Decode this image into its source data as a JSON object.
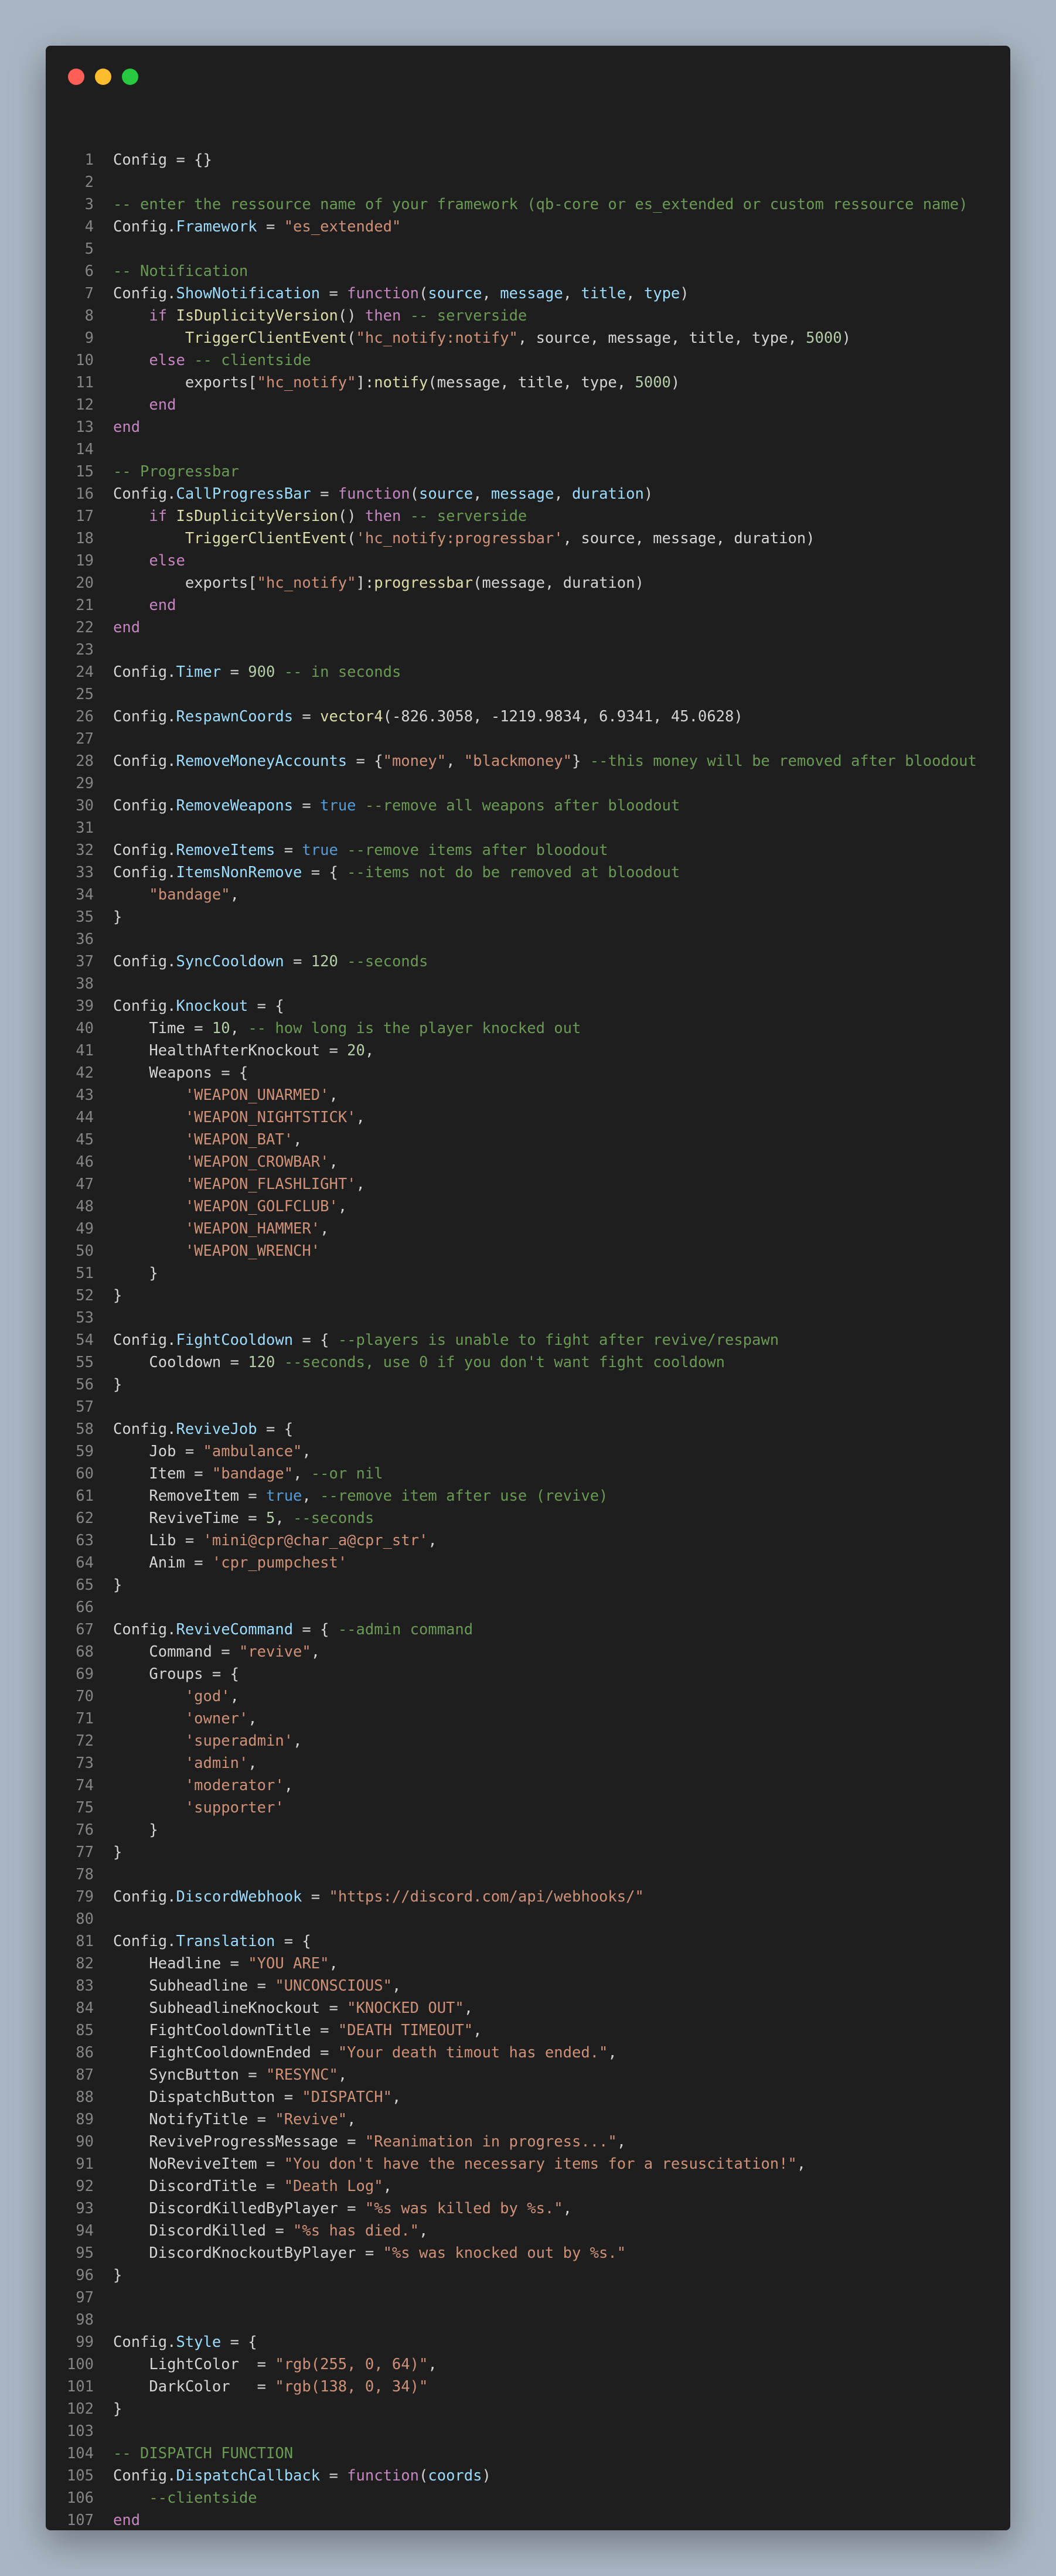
{
  "window": {
    "traffic_lights": [
      "close",
      "minimize",
      "maximize"
    ],
    "colors": {
      "background": "#1e1e1e",
      "close": "#ff5f57",
      "minimize": "#febc2e",
      "maximize": "#28c840"
    }
  },
  "syntax_colors": {
    "plain": "#d4d4d4",
    "keyword": "#c586c0",
    "function": "#dcdcaa",
    "property": "#9cdcfe",
    "string": "#ce9178",
    "number": "#b5cea8",
    "comment": "#6a9955",
    "boolean": "#569cd6",
    "line_number": "#858585"
  },
  "code_lines": [
    [
      [
        "p",
        "Config = {}"
      ]
    ],
    [],
    [
      [
        "cm",
        "-- enter the ressource name of your framework (qb-core or es_extended or custom ressource name)"
      ]
    ],
    [
      [
        "p",
        "Config."
      ],
      [
        "pr",
        "Framework"
      ],
      [
        "p",
        " = "
      ],
      [
        "s",
        "\"es_extended\""
      ]
    ],
    [],
    [
      [
        "cm",
        "-- Notification"
      ]
    ],
    [
      [
        "p",
        "Config."
      ],
      [
        "pr",
        "ShowNotification"
      ],
      [
        "p",
        " = "
      ],
      [
        "k",
        "function"
      ],
      [
        "p",
        "("
      ],
      [
        "pr",
        "source"
      ],
      [
        "p",
        ", "
      ],
      [
        "pr",
        "message"
      ],
      [
        "p",
        ", "
      ],
      [
        "pr",
        "title"
      ],
      [
        "p",
        ", "
      ],
      [
        "pr",
        "type"
      ],
      [
        "p",
        ")"
      ]
    ],
    [
      [
        "p",
        "    "
      ],
      [
        "k",
        "if"
      ],
      [
        "p",
        " "
      ],
      [
        "f",
        "IsDuplicityVersion"
      ],
      [
        "p",
        "() "
      ],
      [
        "k",
        "then"
      ],
      [
        "p",
        " "
      ],
      [
        "cm",
        "-- serverside"
      ]
    ],
    [
      [
        "p",
        "        "
      ],
      [
        "f",
        "TriggerClientEvent"
      ],
      [
        "p",
        "("
      ],
      [
        "s",
        "\"hc_notify:notify\""
      ],
      [
        "p",
        ", source, message, title, type, "
      ],
      [
        "n",
        "5000"
      ],
      [
        "p",
        ")"
      ]
    ],
    [
      [
        "p",
        "    "
      ],
      [
        "k",
        "else"
      ],
      [
        "p",
        " "
      ],
      [
        "cm",
        "-- clientside"
      ]
    ],
    [
      [
        "p",
        "        exports["
      ],
      [
        "s",
        "\"hc_notify\""
      ],
      [
        "p",
        "]:"
      ],
      [
        "f",
        "notify"
      ],
      [
        "p",
        "(message, title, type, "
      ],
      [
        "n",
        "5000"
      ],
      [
        "p",
        ")"
      ]
    ],
    [
      [
        "p",
        "    "
      ],
      [
        "k",
        "end"
      ]
    ],
    [
      [
        "k",
        "end"
      ]
    ],
    [],
    [
      [
        "cm",
        "-- Progressbar"
      ]
    ],
    [
      [
        "p",
        "Config."
      ],
      [
        "pr",
        "CallProgressBar"
      ],
      [
        "p",
        " = "
      ],
      [
        "k",
        "function"
      ],
      [
        "p",
        "("
      ],
      [
        "pr",
        "source"
      ],
      [
        "p",
        ", "
      ],
      [
        "pr",
        "message"
      ],
      [
        "p",
        ", "
      ],
      [
        "pr",
        "duration"
      ],
      [
        "p",
        ")"
      ]
    ],
    [
      [
        "p",
        "    "
      ],
      [
        "k",
        "if"
      ],
      [
        "p",
        " "
      ],
      [
        "f",
        "IsDuplicityVersion"
      ],
      [
        "p",
        "() "
      ],
      [
        "k",
        "then"
      ],
      [
        "p",
        " "
      ],
      [
        "cm",
        "-- serverside"
      ]
    ],
    [
      [
        "p",
        "        "
      ],
      [
        "f",
        "TriggerClientEvent"
      ],
      [
        "p",
        "("
      ],
      [
        "s",
        "'hc_notify:progressbar'"
      ],
      [
        "p",
        ", source, message, duration)"
      ]
    ],
    [
      [
        "p",
        "    "
      ],
      [
        "k",
        "else"
      ]
    ],
    [
      [
        "p",
        "        exports["
      ],
      [
        "s",
        "\"hc_notify\""
      ],
      [
        "p",
        "]:"
      ],
      [
        "f",
        "progressbar"
      ],
      [
        "p",
        "(message, duration)"
      ]
    ],
    [
      [
        "p",
        "    "
      ],
      [
        "k",
        "end"
      ]
    ],
    [
      [
        "k",
        "end"
      ]
    ],
    [],
    [
      [
        "p",
        "Config."
      ],
      [
        "pr",
        "Timer"
      ],
      [
        "p",
        " = "
      ],
      [
        "n",
        "900"
      ],
      [
        "p",
        " "
      ],
      [
        "cm",
        "-- in seconds"
      ]
    ],
    [],
    [
      [
        "p",
        "Config."
      ],
      [
        "pr",
        "RespawnCoords"
      ],
      [
        "p",
        " = "
      ],
      [
        "f",
        "vector4"
      ],
      [
        "p",
        "(-826.3058, -1219.9834, 6.9341, 45.0628)"
      ]
    ],
    [],
    [
      [
        "p",
        "Config."
      ],
      [
        "pr",
        "RemoveMoneyAccounts"
      ],
      [
        "p",
        " = {"
      ],
      [
        "s",
        "\"money\""
      ],
      [
        "p",
        ", "
      ],
      [
        "s",
        "\"blackmoney\""
      ],
      [
        "p",
        "} "
      ],
      [
        "cm",
        "--this money will be removed after bloodout"
      ]
    ],
    [],
    [
      [
        "p",
        "Config."
      ],
      [
        "pr",
        "RemoveWeapons"
      ],
      [
        "p",
        " = "
      ],
      [
        "b",
        "true"
      ],
      [
        "p",
        " "
      ],
      [
        "cm",
        "--remove all weapons after bloodout"
      ]
    ],
    [],
    [
      [
        "p",
        "Config."
      ],
      [
        "pr",
        "RemoveItems"
      ],
      [
        "p",
        " = "
      ],
      [
        "b",
        "true"
      ],
      [
        "p",
        " "
      ],
      [
        "cm",
        "--remove items after bloodout"
      ]
    ],
    [
      [
        "p",
        "Config."
      ],
      [
        "pr",
        "ItemsNonRemove"
      ],
      [
        "p",
        " = { "
      ],
      [
        "cm",
        "--items not do be removed at bloodout"
      ]
    ],
    [
      [
        "p",
        "    "
      ],
      [
        "s",
        "\"bandage\""
      ],
      [
        "p",
        ","
      ]
    ],
    [
      [
        "p",
        "}"
      ]
    ],
    [],
    [
      [
        "p",
        "Config."
      ],
      [
        "pr",
        "SyncCooldown"
      ],
      [
        "p",
        " = "
      ],
      [
        "n",
        "120"
      ],
      [
        "p",
        " "
      ],
      [
        "cm",
        "--seconds"
      ]
    ],
    [],
    [
      [
        "p",
        "Config."
      ],
      [
        "pr",
        "Knockout"
      ],
      [
        "p",
        " = {"
      ]
    ],
    [
      [
        "p",
        "    Time = "
      ],
      [
        "n",
        "10"
      ],
      [
        "p",
        ", "
      ],
      [
        "cm",
        "-- how long is the player knocked out"
      ]
    ],
    [
      [
        "p",
        "    HealthAfterKnockout = "
      ],
      [
        "n",
        "20"
      ],
      [
        "p",
        ","
      ]
    ],
    [
      [
        "p",
        "    Weapons = {"
      ]
    ],
    [
      [
        "p",
        "        "
      ],
      [
        "s",
        "'WEAPON_UNARMED'"
      ],
      [
        "p",
        ","
      ]
    ],
    [
      [
        "p",
        "        "
      ],
      [
        "s",
        "'WEAPON_NIGHTSTICK'"
      ],
      [
        "p",
        ","
      ]
    ],
    [
      [
        "p",
        "        "
      ],
      [
        "s",
        "'WEAPON_BAT'"
      ],
      [
        "p",
        ","
      ]
    ],
    [
      [
        "p",
        "        "
      ],
      [
        "s",
        "'WEAPON_CROWBAR'"
      ],
      [
        "p",
        ","
      ]
    ],
    [
      [
        "p",
        "        "
      ],
      [
        "s",
        "'WEAPON_FLASHLIGHT'"
      ],
      [
        "p",
        ","
      ]
    ],
    [
      [
        "p",
        "        "
      ],
      [
        "s",
        "'WEAPON_GOLFCLUB'"
      ],
      [
        "p",
        ","
      ]
    ],
    [
      [
        "p",
        "        "
      ],
      [
        "s",
        "'WEAPON_HAMMER'"
      ],
      [
        "p",
        ","
      ]
    ],
    [
      [
        "p",
        "        "
      ],
      [
        "s",
        "'WEAPON_WRENCH'"
      ]
    ],
    [
      [
        "p",
        "    }"
      ]
    ],
    [
      [
        "p",
        "}"
      ]
    ],
    [],
    [
      [
        "p",
        "Config."
      ],
      [
        "pr",
        "FightCooldown"
      ],
      [
        "p",
        " = { "
      ],
      [
        "cm",
        "--players is unable to fight after revive/respawn"
      ]
    ],
    [
      [
        "p",
        "    Cooldown = "
      ],
      [
        "n",
        "120"
      ],
      [
        "p",
        " "
      ],
      [
        "cm",
        "--seconds, use 0 if you don't want fight cooldown"
      ]
    ],
    [
      [
        "p",
        "}"
      ]
    ],
    [],
    [
      [
        "p",
        "Config."
      ],
      [
        "pr",
        "ReviveJob"
      ],
      [
        "p",
        " = {"
      ]
    ],
    [
      [
        "p",
        "    Job = "
      ],
      [
        "s",
        "\"ambulance\""
      ],
      [
        "p",
        ","
      ]
    ],
    [
      [
        "p",
        "    Item = "
      ],
      [
        "s",
        "\"bandage\""
      ],
      [
        "p",
        ", "
      ],
      [
        "cm",
        "--or nil"
      ]
    ],
    [
      [
        "p",
        "    RemoveItem = "
      ],
      [
        "b",
        "true"
      ],
      [
        "p",
        ", "
      ],
      [
        "cm",
        "--remove item after use (revive)"
      ]
    ],
    [
      [
        "p",
        "    ReviveTime = "
      ],
      [
        "n",
        "5"
      ],
      [
        "p",
        ", "
      ],
      [
        "cm",
        "--seconds"
      ]
    ],
    [
      [
        "p",
        "    Lib = "
      ],
      [
        "s",
        "'mini@cpr@char_a@cpr_str'"
      ],
      [
        "p",
        ","
      ]
    ],
    [
      [
        "p",
        "    Anim = "
      ],
      [
        "s",
        "'cpr_pumpchest'"
      ]
    ],
    [
      [
        "p",
        "}"
      ]
    ],
    [],
    [
      [
        "p",
        "Config."
      ],
      [
        "pr",
        "ReviveCommand"
      ],
      [
        "p",
        " = { "
      ],
      [
        "cm",
        "--admin command"
      ]
    ],
    [
      [
        "p",
        "    Command = "
      ],
      [
        "s",
        "\"revive\""
      ],
      [
        "p",
        ","
      ]
    ],
    [
      [
        "p",
        "    Groups = {"
      ]
    ],
    [
      [
        "p",
        "        "
      ],
      [
        "s",
        "'god'"
      ],
      [
        "p",
        ","
      ]
    ],
    [
      [
        "p",
        "        "
      ],
      [
        "s",
        "'owner'"
      ],
      [
        "p",
        ","
      ]
    ],
    [
      [
        "p",
        "        "
      ],
      [
        "s",
        "'superadmin'"
      ],
      [
        "p",
        ","
      ]
    ],
    [
      [
        "p",
        "        "
      ],
      [
        "s",
        "'admin'"
      ],
      [
        "p",
        ","
      ]
    ],
    [
      [
        "p",
        "        "
      ],
      [
        "s",
        "'moderator'"
      ],
      [
        "p",
        ","
      ]
    ],
    [
      [
        "p",
        "        "
      ],
      [
        "s",
        "'supporter'"
      ]
    ],
    [
      [
        "p",
        "    }"
      ]
    ],
    [
      [
        "p",
        "}"
      ]
    ],
    [],
    [
      [
        "p",
        "Config."
      ],
      [
        "pr",
        "DiscordWebhook"
      ],
      [
        "p",
        " = "
      ],
      [
        "s",
        "\"https://discord.com/api/webhooks/\""
      ]
    ],
    [],
    [
      [
        "p",
        "Config."
      ],
      [
        "pr",
        "Translation"
      ],
      [
        "p",
        " = {"
      ]
    ],
    [
      [
        "p",
        "    Headline = "
      ],
      [
        "s",
        "\"YOU ARE\""
      ],
      [
        "p",
        ","
      ]
    ],
    [
      [
        "p",
        "    Subheadline = "
      ],
      [
        "s",
        "\"UNCONSCIOUS\""
      ],
      [
        "p",
        ","
      ]
    ],
    [
      [
        "p",
        "    SubheadlineKnockout = "
      ],
      [
        "s",
        "\"KNOCKED OUT\""
      ],
      [
        "p",
        ","
      ]
    ],
    [
      [
        "p",
        "    FightCooldownTitle = "
      ],
      [
        "s",
        "\"DEATH TIMEOUT\""
      ],
      [
        "p",
        ","
      ]
    ],
    [
      [
        "p",
        "    FightCooldownEnded = "
      ],
      [
        "s",
        "\"Your death timout has ended.\""
      ],
      [
        "p",
        ","
      ]
    ],
    [
      [
        "p",
        "    SyncButton = "
      ],
      [
        "s",
        "\"RESYNC\""
      ],
      [
        "p",
        ","
      ]
    ],
    [
      [
        "p",
        "    DispatchButton = "
      ],
      [
        "s",
        "\"DISPATCH\""
      ],
      [
        "p",
        ","
      ]
    ],
    [
      [
        "p",
        "    NotifyTitle = "
      ],
      [
        "s",
        "\"Revive\""
      ],
      [
        "p",
        ","
      ]
    ],
    [
      [
        "p",
        "    ReviveProgressMessage = "
      ],
      [
        "s",
        "\"Reanimation in progress...\""
      ],
      [
        "p",
        ","
      ]
    ],
    [
      [
        "p",
        "    NoReviveItem = "
      ],
      [
        "s",
        "\"You don't have the necessary items for a resuscitation!\""
      ],
      [
        "p",
        ","
      ]
    ],
    [
      [
        "p",
        "    DiscordTitle = "
      ],
      [
        "s",
        "\"Death Log\""
      ],
      [
        "p",
        ","
      ]
    ],
    [
      [
        "p",
        "    DiscordKilledByPlayer = "
      ],
      [
        "s",
        "\"%s was killed by %s.\""
      ],
      [
        "p",
        ","
      ]
    ],
    [
      [
        "p",
        "    DiscordKilled = "
      ],
      [
        "s",
        "\"%s has died.\""
      ],
      [
        "p",
        ","
      ]
    ],
    [
      [
        "p",
        "    DiscordKnockoutByPlayer = "
      ],
      [
        "s",
        "\"%s was knocked out by %s.\""
      ]
    ],
    [
      [
        "p",
        "}"
      ]
    ],
    [],
    [],
    [
      [
        "p",
        "Config."
      ],
      [
        "pr",
        "Style"
      ],
      [
        "p",
        " = {"
      ]
    ],
    [
      [
        "p",
        "    LightColor  = "
      ],
      [
        "s",
        "\"rgb(255, 0, 64)\""
      ],
      [
        "p",
        ","
      ]
    ],
    [
      [
        "p",
        "    DarkColor   = "
      ],
      [
        "s",
        "\"rgb(138, 0, 34)\""
      ]
    ],
    [
      [
        "p",
        "}"
      ]
    ],
    [],
    [
      [
        "cm",
        "-- DISPATCH FUNCTION"
      ]
    ],
    [
      [
        "p",
        "Config."
      ],
      [
        "pr",
        "DispatchCallback"
      ],
      [
        "p",
        " = "
      ],
      [
        "k",
        "function"
      ],
      [
        "p",
        "("
      ],
      [
        "pr",
        "coords"
      ],
      [
        "p",
        ")"
      ]
    ],
    [
      [
        "p",
        "    "
      ],
      [
        "cm",
        "--clientside"
      ]
    ],
    [
      [
        "k",
        "end"
      ]
    ],
    []
  ]
}
